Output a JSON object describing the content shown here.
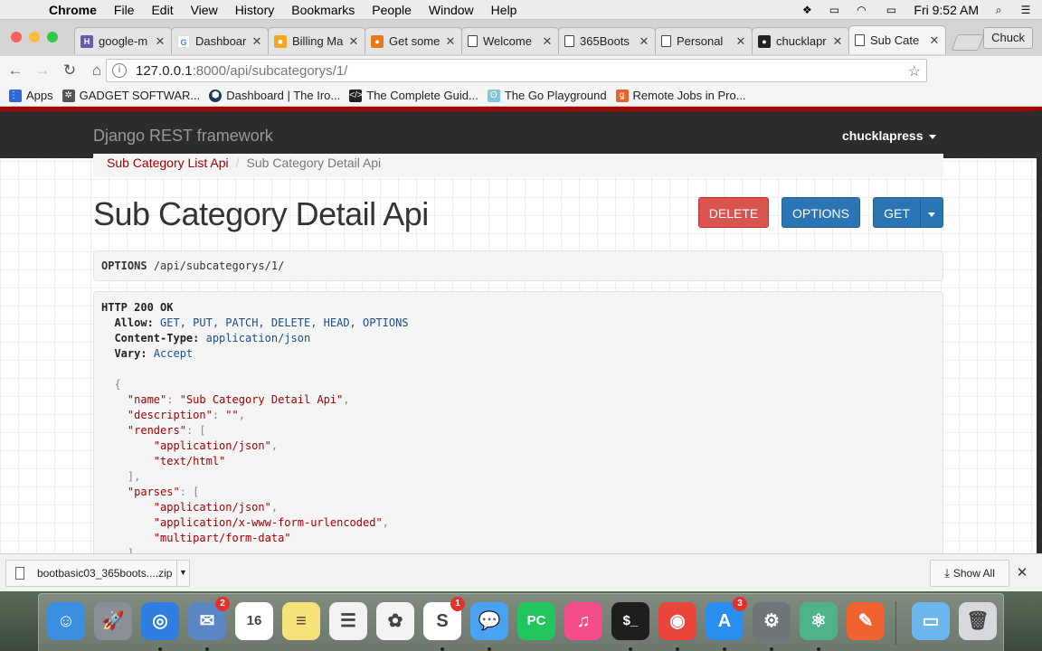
{
  "menubar": {
    "app_name": "Chrome",
    "items": [
      "File",
      "Edit",
      "View",
      "History",
      "Bookmarks",
      "People",
      "Window",
      "Help"
    ],
    "clock": "Fri 9:52 AM",
    "tray_icons": [
      "dropbox-icon",
      "airplay-icon",
      "wifi-icon",
      "battery-icon"
    ]
  },
  "tabs": [
    {
      "title": "google-m",
      "favicon": "heroku",
      "color": "#6a5aa8",
      "glyph": "H"
    },
    {
      "title": "Dashboar",
      "favicon": "google",
      "color": "#ffffff",
      "glyph": "G"
    },
    {
      "title": "Billing Ma",
      "favicon": "aws-box",
      "color": "#f4a71d",
      "glyph": "■"
    },
    {
      "title": "Get some",
      "favicon": "orange-circle",
      "color": "#e57a1c",
      "glyph": "●"
    },
    {
      "title": "Welcome",
      "favicon": "document",
      "color": "#ffffff",
      "glyph": ""
    },
    {
      "title": "365Boots",
      "favicon": "document",
      "color": "#ffffff",
      "glyph": ""
    },
    {
      "title": "Personal",
      "favicon": "document",
      "color": "#ffffff",
      "glyph": ""
    },
    {
      "title": "chucklapr",
      "favicon": "github",
      "color": "#222222",
      "glyph": "●"
    },
    {
      "title": "Sub Cate",
      "favicon": "document",
      "color": "#ffffff",
      "glyph": ""
    }
  ],
  "profile_name": "Chuck",
  "address": {
    "host": "127.0.0.1",
    "path": ":8000/api/subcategorys/1/"
  },
  "bookmarks": [
    {
      "label": "Apps",
      "color": "#3367d6"
    },
    {
      "label": "GADGET SOFTWAR...",
      "color": "#555555"
    },
    {
      "label": "Dashboard | The Iro...",
      "color": "#1b3a5c"
    },
    {
      "label": "The Complete Guid...",
      "color": "#222222"
    },
    {
      "label": "The Go Playground",
      "color": "#7fc6d8"
    },
    {
      "label": "Remote Jobs in Pro...",
      "color": "#e8632b"
    }
  ],
  "drf": {
    "brand": "Django REST framework",
    "user": "chucklapress",
    "breadcrumb": {
      "link": "Sub Category List Api",
      "active": "Sub Category Detail Api"
    },
    "title": "Sub Category Detail Api",
    "buttons": {
      "delete": "DELETE",
      "options": "OPTIONS",
      "get": "GET"
    },
    "request": {
      "method": "OPTIONS",
      "path": "/api/subcategorys/1/"
    },
    "response": {
      "status": "HTTP 200 OK",
      "headers": [
        {
          "key": "Allow:",
          "value": "GET, PUT, PATCH, DELETE, HEAD, OPTIONS"
        },
        {
          "key": "Content-Type:",
          "value": "application/json"
        },
        {
          "key": "Vary:",
          "value": "Accept"
        }
      ],
      "body": {
        "name": "Sub Category Detail Api",
        "description": "",
        "renders": [
          "application/json",
          "text/html"
        ],
        "parses": [
          "application/json",
          "application/x-www-form-urlencoded",
          "multipart/form-data"
        ]
      }
    }
  },
  "download": {
    "filename": "bootbasic03_365boots....zip",
    "show_all": "Show All"
  },
  "dock": [
    {
      "name": "finder-icon",
      "color": "#3a8fe0",
      "glyph": "☺",
      "badge": ""
    },
    {
      "name": "launchpad-icon",
      "color": "#8a8f96",
      "glyph": "🚀",
      "badge": ""
    },
    {
      "name": "safari-icon",
      "color": "#2f7de1",
      "glyph": "◎",
      "badge": ""
    },
    {
      "name": "mail-eagle-icon",
      "color": "#5b86c4",
      "glyph": "✉",
      "badge": "2"
    },
    {
      "name": "calendar-icon",
      "color": "#ffffff",
      "glyph": "16",
      "badge": ""
    },
    {
      "name": "notes-icon",
      "color": "#f7e27a",
      "glyph": "≡",
      "badge": ""
    },
    {
      "name": "reminders-icon",
      "color": "#f2f2f2",
      "glyph": "☰",
      "badge": ""
    },
    {
      "name": "photos-icon",
      "color": "#f3f3f3",
      "glyph": "✿",
      "badge": ""
    },
    {
      "name": "slack-icon",
      "color": "#ffffff",
      "glyph": "S",
      "badge": "1"
    },
    {
      "name": "messages-icon",
      "color": "#4aa3f2",
      "glyph": "💬",
      "badge": ""
    },
    {
      "name": "pycharm-icon",
      "color": "#22c55e",
      "glyph": "PC",
      "badge": ""
    },
    {
      "name": "itunes-icon",
      "color": "#f44d8a",
      "glyph": "♫",
      "badge": ""
    },
    {
      "name": "terminal-icon",
      "color": "#1e1e1e",
      "glyph": "$_",
      "badge": ""
    },
    {
      "name": "chrome-icon",
      "color": "#e9453b",
      "glyph": "◉",
      "badge": ""
    },
    {
      "name": "app-store-icon",
      "color": "#2a8ef0",
      "glyph": "A",
      "badge": "3"
    },
    {
      "name": "system-preferences-icon",
      "color": "#6f7478",
      "glyph": "⚙",
      "badge": ""
    },
    {
      "name": "atom-icon",
      "color": "#4fb38a",
      "glyph": "⚛",
      "badge": ""
    },
    {
      "name": "postman-icon",
      "color": "#f0622e",
      "glyph": "✎",
      "badge": ""
    },
    {
      "name": "downloads-folder-icon",
      "color": "#6cb6ee",
      "glyph": "▭",
      "badge": ""
    },
    {
      "name": "trash-icon",
      "color": "#d7dadd",
      "glyph": "🗑",
      "badge": ""
    }
  ]
}
